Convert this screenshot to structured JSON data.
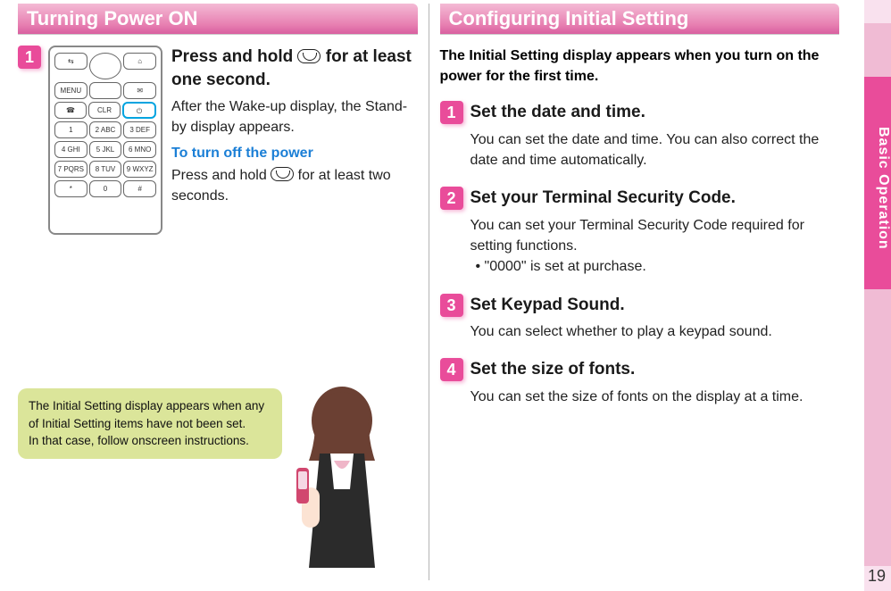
{
  "left": {
    "title": "Turning Power ON",
    "step1": {
      "num": "1",
      "head_a": "Press and hold ",
      "head_b": " for at least one second.",
      "text1": "After the Wake-up display, the Stand-by display appears.",
      "sub": "To turn off the power",
      "text2a": "Press and hold ",
      "text2b": " for at least two seconds."
    },
    "bubble": "The Initial Setting display appears when any of Initial Setting items have not been set.\nIn that case, follow onscreen instructions."
  },
  "right": {
    "title": "Configuring Initial Setting",
    "intro": "The Initial Setting display appears when you turn on the power for the first time.",
    "steps": [
      {
        "num": "1",
        "head": "Set the date and time.",
        "text": "You can set the date and time. You can also correct the date and time automatically."
      },
      {
        "num": "2",
        "head": "Set your Terminal Security Code.",
        "text": "You can set your Terminal Security Code required for setting functions.",
        "bullet": "• \"0000\" is set at purchase."
      },
      {
        "num": "3",
        "head": "Set Keypad Sound.",
        "text": "You can select whether to play a keypad sound."
      },
      {
        "num": "4",
        "head": "Set the size of fonts.",
        "text": "You can set the size of fonts on the display at a time."
      }
    ]
  },
  "side": {
    "label": "Basic Operation"
  },
  "pagenum": "19",
  "keypad": {
    "row1": [
      "⇆",
      "",
      "⌂"
    ],
    "row2": [
      "MENU",
      "",
      "✉"
    ],
    "row3": [
      "☎",
      "CLR",
      "⏻"
    ],
    "row4": [
      "1",
      "2 ABC",
      "3 DEF"
    ],
    "row5": [
      "4 GHI",
      "5 JKL",
      "6 MNO"
    ],
    "row6": [
      "7 PQRS",
      "8 TUV",
      "9 WXYZ"
    ],
    "row7": [
      "*",
      "0",
      "#"
    ]
  }
}
